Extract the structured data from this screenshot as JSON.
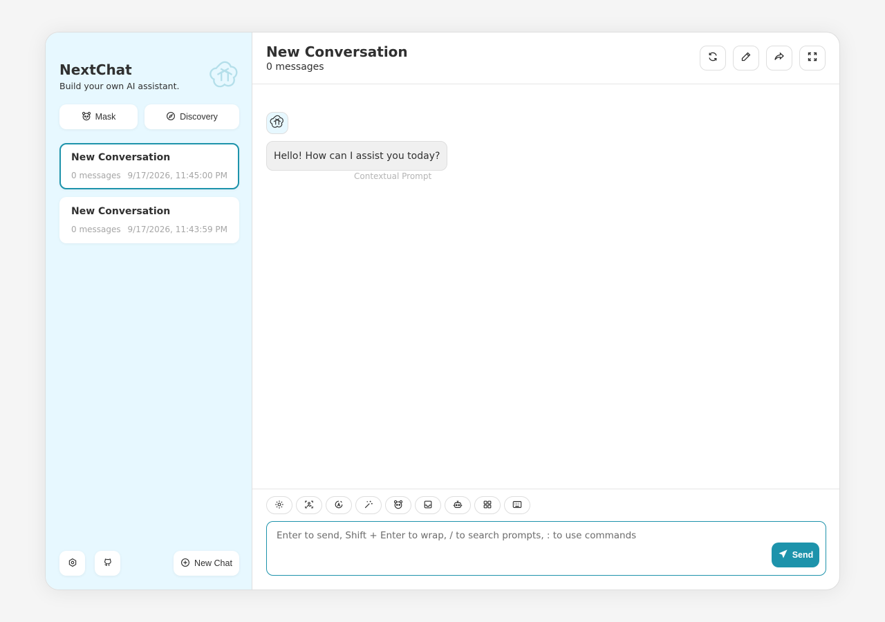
{
  "app": {
    "name": "NextChat",
    "tagline": "Build your own AI assistant.",
    "accent_color": "#1d93ab",
    "sidebar_bg": "#e7f8ff"
  },
  "sidebar": {
    "actions": [
      {
        "label": "Mask",
        "icon": "mask-icon"
      },
      {
        "label": "Discovery",
        "icon": "discovery-icon"
      }
    ],
    "chats": [
      {
        "title": "New Conversation",
        "count": "0 messages",
        "time": "9/17/2026, 11:45:00 PM",
        "selected": true
      },
      {
        "title": "New Conversation",
        "count": "0 messages",
        "time": "9/17/2026, 11:43:59 PM",
        "selected": false
      }
    ],
    "bottom": {
      "settings_icon": "settings-icon",
      "github_icon": "github-icon",
      "new_chat_label": "New Chat"
    }
  },
  "header": {
    "title": "New Conversation",
    "subtitle": "0 messages",
    "actions": [
      "refresh-icon",
      "edit-icon",
      "share-icon",
      "fullscreen-icon"
    ]
  },
  "messages": [
    {
      "role": "assistant",
      "text": "Hello! How can I assist you today?",
      "note": "Contextual Prompt"
    }
  ],
  "composer": {
    "placeholder": "Enter to send, Shift + Enter to wrap, / to search prompts, : to use commands",
    "value": "",
    "send_label": "Send",
    "tools": [
      "settings-icon",
      "image-icon",
      "theme-icon",
      "prompt-wand-icon",
      "mask-icon",
      "clear-context-icon",
      "model-robot-icon",
      "plugin-grid-icon",
      "shortcut-keyboard-icon"
    ]
  }
}
